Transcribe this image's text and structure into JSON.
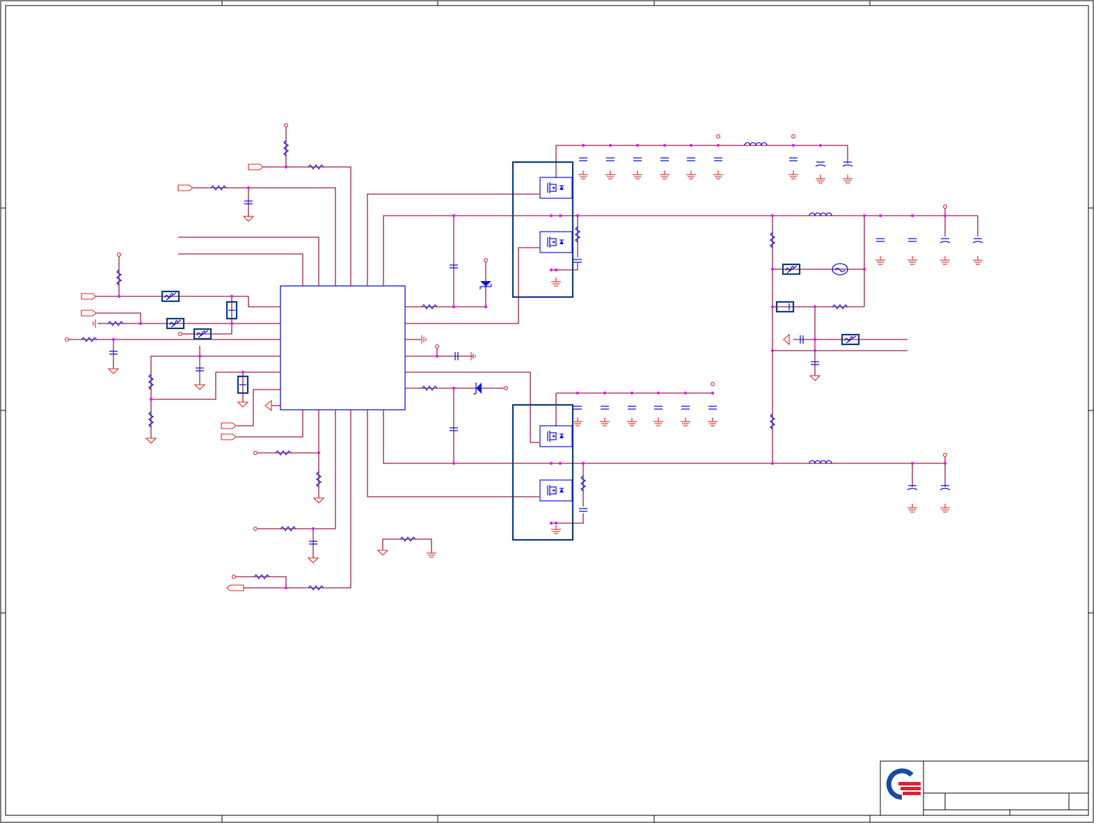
{
  "sheet": {
    "title_block": {
      "title": "",
      "size": "",
      "document_number": "",
      "rev": "",
      "date": "",
      "sheet": ""
    }
  },
  "colors": {
    "wire": "#9c1c4a",
    "component_outline": "#1010e0",
    "power_symbol": "#e02020",
    "junction": "#e020e0",
    "module_box": "#0a3a80",
    "logo_blue": "#1a4aa0",
    "logo_red": "#e02030"
  },
  "components": {
    "controller_ic": "ic-outline",
    "high_side_mosfets": 2,
    "low_side_mosfets": 2,
    "output_inductors": 2,
    "input_inductor": 1
  },
  "icons": [
    "resistor-icon",
    "capacitor-icon",
    "inductor-icon",
    "mosfet-icon",
    "ground-icon",
    "diode-icon",
    "zener-icon",
    "fuse-icon",
    "polyfuse-icon",
    "test-point-icon",
    "offpage-connector-icon",
    "company-logo-icon"
  ]
}
